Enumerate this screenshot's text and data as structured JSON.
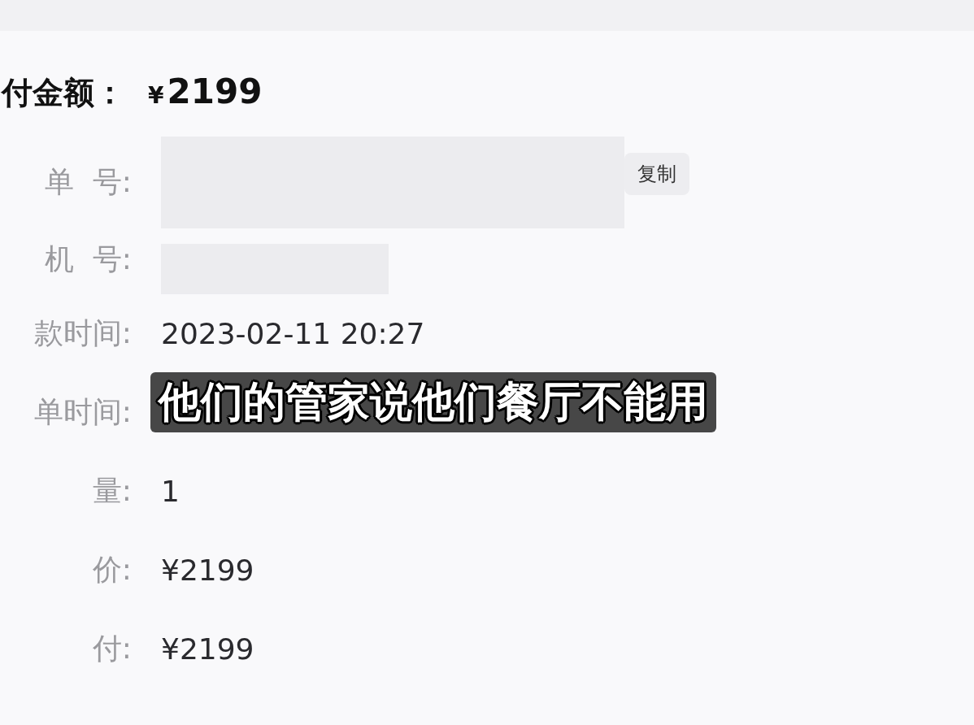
{
  "total": {
    "label": "付金额：",
    "currency": "¥",
    "amount": "2199"
  },
  "fields": [
    {
      "label": "单  号:",
      "kind": "redacted",
      "action": "复制"
    },
    {
      "label": "机  号:",
      "kind": "redacted-short"
    },
    {
      "label": "款时间:",
      "kind": "text",
      "value": "2023-02-11 20:27"
    },
    {
      "label": "单时间:",
      "kind": "hidden"
    },
    {
      "label": "量:",
      "kind": "text",
      "value": "1"
    },
    {
      "label": "价:",
      "kind": "text",
      "value": "¥2199"
    },
    {
      "label": "付:",
      "kind": "text",
      "value": "¥2199"
    }
  ],
  "subtitle": "他们的管家说他们餐厅不能用"
}
